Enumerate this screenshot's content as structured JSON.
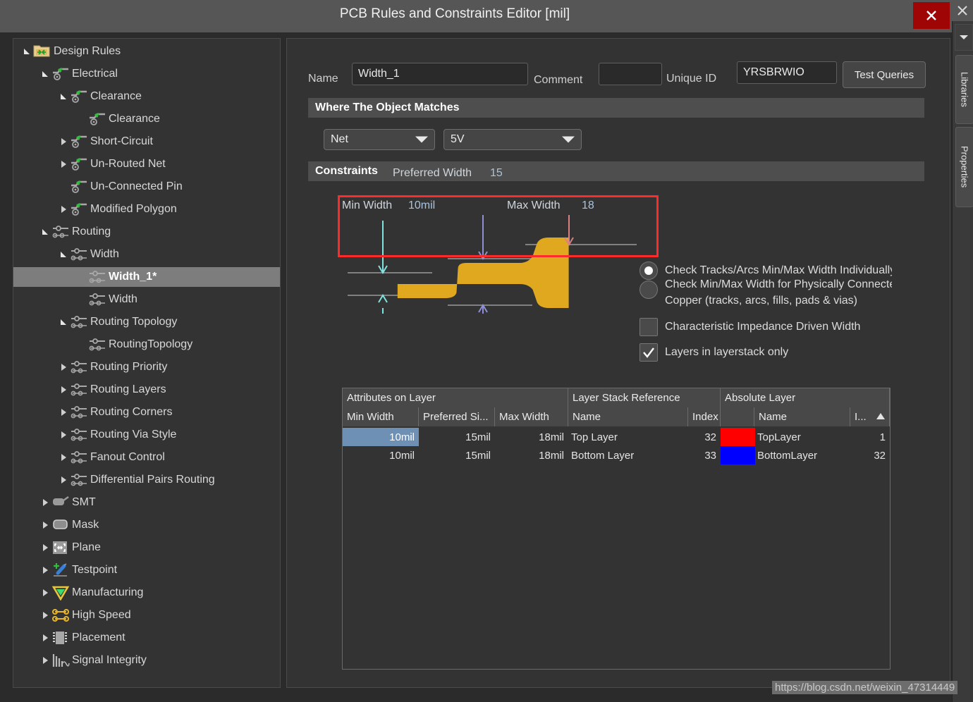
{
  "window": {
    "title": "PCB Rules and Constraints Editor [mil]",
    "close_icon": "close-icon",
    "outer_close_icon": "close-icon"
  },
  "rail": {
    "scroll_icon": "chevron-down-icon",
    "tabs": [
      {
        "label": "Libraries"
      },
      {
        "label": "Properties"
      }
    ]
  },
  "tree": {
    "items": [
      {
        "label": "Design Rules",
        "depth": 0,
        "icon": "folder-design-rules-icon",
        "twisty": "expanded",
        "selected": false
      },
      {
        "label": "Electrical",
        "depth": 1,
        "icon": "electrical-rule-icon",
        "twisty": "expanded",
        "selected": false
      },
      {
        "label": "Clearance",
        "depth": 2,
        "icon": "electrical-rule-icon",
        "twisty": "expanded",
        "selected": false
      },
      {
        "label": "Clearance",
        "depth": 3,
        "icon": "electrical-rule-icon",
        "twisty": "none",
        "selected": false
      },
      {
        "label": "Short-Circuit",
        "depth": 2,
        "icon": "electrical-rule-icon",
        "twisty": "collapsed",
        "selected": false
      },
      {
        "label": "Un-Routed Net",
        "depth": 2,
        "icon": "electrical-rule-icon",
        "twisty": "collapsed",
        "selected": false
      },
      {
        "label": "Un-Connected Pin",
        "depth": 2,
        "icon": "electrical-rule-icon",
        "twisty": "none",
        "selected": false
      },
      {
        "label": "Modified Polygon",
        "depth": 2,
        "icon": "electrical-rule-icon",
        "twisty": "collapsed",
        "selected": false
      },
      {
        "label": "Routing",
        "depth": 1,
        "icon": "routing-rule-icon",
        "twisty": "expanded",
        "selected": false
      },
      {
        "label": "Width",
        "depth": 2,
        "icon": "routing-rule-icon",
        "twisty": "expanded",
        "selected": false
      },
      {
        "label": "Width_1*",
        "depth": 3,
        "icon": "routing-rule-icon",
        "twisty": "none",
        "selected": true
      },
      {
        "label": "Width",
        "depth": 3,
        "icon": "routing-rule-icon",
        "twisty": "none",
        "selected": false
      },
      {
        "label": "Routing Topology",
        "depth": 2,
        "icon": "routing-rule-icon",
        "twisty": "expanded",
        "selected": false
      },
      {
        "label": "RoutingTopology",
        "depth": 3,
        "icon": "routing-rule-icon",
        "twisty": "none",
        "selected": false
      },
      {
        "label": "Routing Priority",
        "depth": 2,
        "icon": "routing-rule-icon",
        "twisty": "collapsed",
        "selected": false
      },
      {
        "label": "Routing Layers",
        "depth": 2,
        "icon": "routing-rule-icon",
        "twisty": "collapsed",
        "selected": false
      },
      {
        "label": "Routing Corners",
        "depth": 2,
        "icon": "routing-rule-icon",
        "twisty": "collapsed",
        "selected": false
      },
      {
        "label": "Routing Via Style",
        "depth": 2,
        "icon": "routing-rule-icon",
        "twisty": "collapsed",
        "selected": false
      },
      {
        "label": "Fanout Control",
        "depth": 2,
        "icon": "routing-rule-icon",
        "twisty": "collapsed",
        "selected": false
      },
      {
        "label": "Differential Pairs Routing",
        "depth": 2,
        "icon": "routing-rule-icon",
        "twisty": "collapsed",
        "selected": false
      },
      {
        "label": "SMT",
        "depth": 1,
        "icon": "smt-icon",
        "twisty": "collapsed",
        "selected": false
      },
      {
        "label": "Mask",
        "depth": 1,
        "icon": "mask-icon",
        "twisty": "collapsed",
        "selected": false
      },
      {
        "label": "Plane",
        "depth": 1,
        "icon": "plane-icon",
        "twisty": "collapsed",
        "selected": false
      },
      {
        "label": "Testpoint",
        "depth": 1,
        "icon": "testpoint-icon",
        "twisty": "collapsed",
        "selected": false
      },
      {
        "label": "Manufacturing",
        "depth": 1,
        "icon": "manufacturing-icon",
        "twisty": "collapsed",
        "selected": false
      },
      {
        "label": "High Speed",
        "depth": 1,
        "icon": "high-speed-icon",
        "twisty": "collapsed",
        "selected": false
      },
      {
        "label": "Placement",
        "depth": 1,
        "icon": "placement-icon",
        "twisty": "collapsed",
        "selected": false
      },
      {
        "label": "Signal Integrity",
        "depth": 1,
        "icon": "signal-integrity-icon",
        "twisty": "collapsed",
        "selected": false
      }
    ]
  },
  "form": {
    "name_label": "Name",
    "name_value": "Width_1",
    "comment_label": "Comment",
    "comment_value": "",
    "unique_id_label": "Unique ID",
    "unique_id_value": "YRSBRWIO",
    "test_queries_label": "Test Queries"
  },
  "sections": {
    "where_matches": "Where The Object Matches",
    "constraints": "Constraints"
  },
  "scope": {
    "object_kind": "Net",
    "net_value": "5V"
  },
  "constraints": {
    "preferred_width_label": "Preferred Width",
    "preferred_width_value": "15",
    "min_width_label": "Min Width",
    "min_width_value": "10mil",
    "max_width_label": "Max Width",
    "max_width_value": "18",
    "highlight_color": "#ff2a2a",
    "trace_color": "#e0a81e",
    "options": [
      {
        "type": "radio",
        "label": "Check Tracks/Arcs Min/Max Width Individually",
        "checked": true
      },
      {
        "type": "radio",
        "label": "Check Min/Max Width for Physically Connected",
        "label2": "Copper (tracks, arcs, fills, pads & vias)",
        "checked": false
      },
      {
        "type": "checkbox",
        "label": "Characteristic Impedance Driven Width",
        "checked": false
      },
      {
        "type": "checkbox",
        "label": "Layers in layerstack only",
        "checked": true
      }
    ]
  },
  "table": {
    "group_headers": [
      {
        "label": "Attributes on Layer"
      },
      {
        "label": "Layer Stack Reference"
      },
      {
        "label": "Absolute Layer"
      }
    ],
    "columns": [
      {
        "label": "Min Width"
      },
      {
        "label": "Preferred Si..."
      },
      {
        "label": "Max Width"
      },
      {
        "label": "Name"
      },
      {
        "label": "Index"
      },
      {
        "label": ""
      },
      {
        "label": "Name"
      },
      {
        "label": "I..."
      }
    ],
    "sort_icon": "sort-ascending-icon",
    "rows": [
      {
        "min_width": "10mil",
        "preferred_size": "15mil",
        "max_width": "18mil",
        "stack_name": "Top Layer",
        "stack_index": "32",
        "color": "#ff0000",
        "abs_name": "TopLayer",
        "abs_index": "1",
        "selected": true
      },
      {
        "min_width": "10mil",
        "preferred_size": "15mil",
        "max_width": "18mil",
        "stack_name": "Bottom Layer",
        "stack_index": "33",
        "color": "#0000ff",
        "abs_name": "BottomLayer",
        "abs_index": "32",
        "selected": false
      }
    ]
  },
  "watermark": "https://blog.csdn.net/weixin_47314449"
}
